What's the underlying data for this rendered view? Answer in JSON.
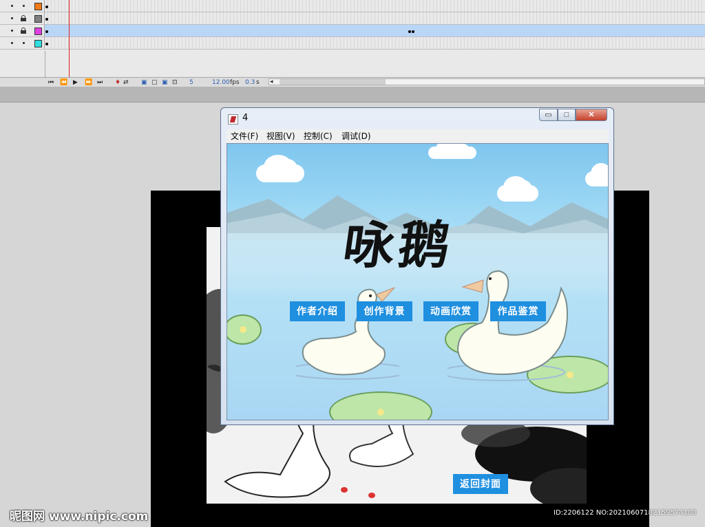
{
  "timeline": {
    "layers": [
      {
        "color": "#f07a18",
        "locked": false,
        "selected": false
      },
      {
        "color": "#808080",
        "locked": true,
        "selected": false
      },
      {
        "color": "#e040e0",
        "locked": true,
        "selected": true
      },
      {
        "color": "#30e0e0",
        "locked": false,
        "selected": false
      }
    ],
    "controls": {
      "current_frame": "5",
      "frame_rate": "12.00",
      "frame_rate_unit": "fps",
      "elapsed": "0.3",
      "elapsed_unit": "s"
    }
  },
  "player": {
    "title": "4",
    "window_buttons": {
      "minimize": "▭",
      "maximize": "□",
      "close": "✕"
    },
    "menu": [
      "文件(F)",
      "视图(V)",
      "控制(C)",
      "调试(D)"
    ],
    "scene": {
      "title": "咏鹅",
      "buttons": [
        "作者介绍",
        "创作背景",
        "动画欣赏",
        "作品鉴赏"
      ]
    }
  },
  "stage": {
    "back_button": "返回封面"
  },
  "watermark": {
    "logo": "昵图网 www.nipic.com",
    "id": "ID:2206122 NO:20210607182159574103"
  },
  "colors": {
    "button_blue": "#1f8fe0",
    "selected_layer": "#b9d6f7",
    "playhead": "#e02020"
  }
}
